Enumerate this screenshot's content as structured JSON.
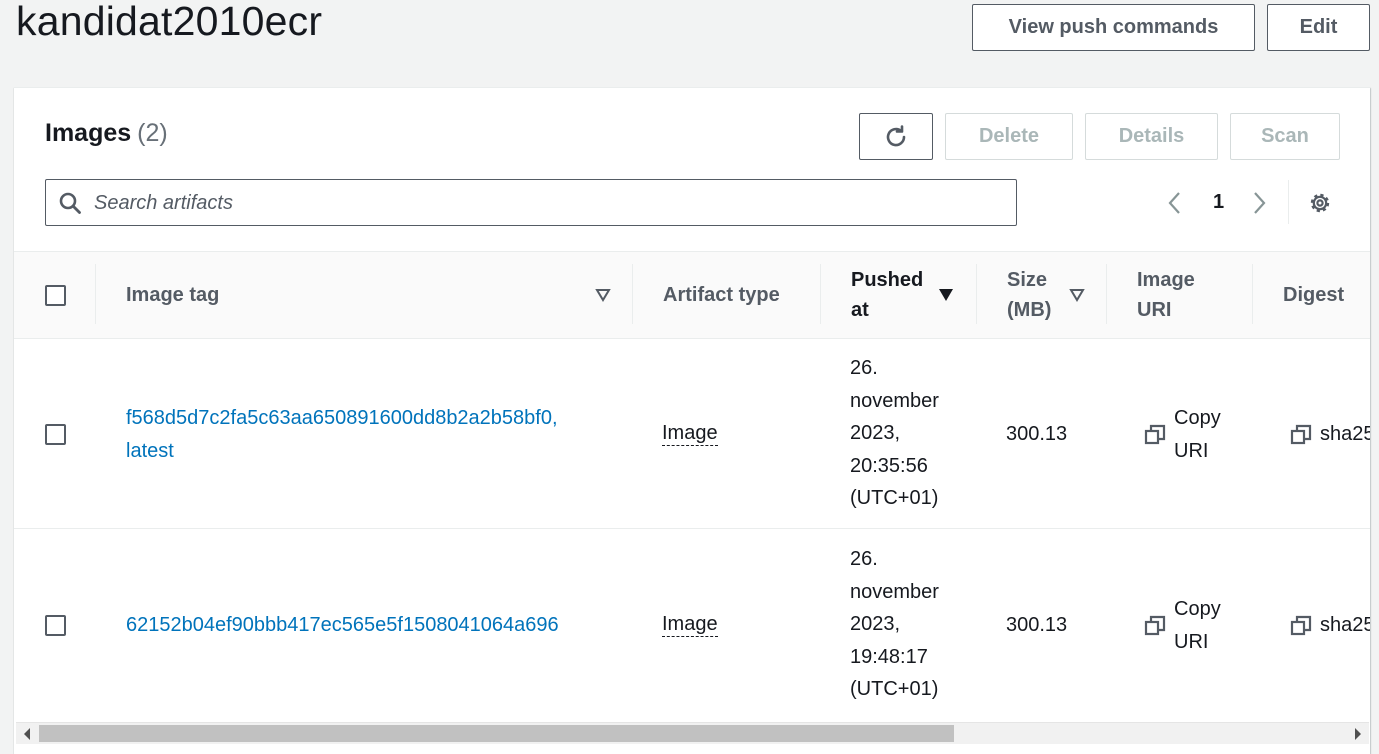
{
  "header": {
    "title": "kandidat2010ecr",
    "view_push_commands": "View push commands",
    "edit": "Edit"
  },
  "images_panel": {
    "title": "Images",
    "count": "(2)",
    "delete": "Delete",
    "details": "Details",
    "scan": "Scan",
    "search_placeholder": "Search artifacts",
    "page": "1"
  },
  "table": {
    "headers": {
      "image_tag": "Image tag",
      "artifact_type": "Artifact type",
      "pushed_at_1": "Pushed",
      "pushed_at_2": "at",
      "size_1": "Size",
      "size_2": "(MB)",
      "image_uri_1": "Image",
      "image_uri_2": "URI",
      "digest": "Digest"
    },
    "rows": [
      {
        "tag_1": "f568d5d7c2fa5c63aa650891600dd8b2a2b58bf0,",
        "tag_2": "latest",
        "artifact_type": "Image",
        "pushed_1": "26.",
        "pushed_2": "november",
        "pushed_3": "2023,",
        "pushed_4": "20:35:56",
        "pushed_5": "(UTC+01)",
        "size": "300.13",
        "copy_1": "Copy",
        "copy_2": "URI",
        "digest": "sha25"
      },
      {
        "tag_1": "62152b04ef90bbb417ec565e5f1508041064a696",
        "tag_2": "",
        "artifact_type": "Image",
        "pushed_1": "26.",
        "pushed_2": "november",
        "pushed_3": "2023,",
        "pushed_4": "19:48:17",
        "pushed_5": "(UTC+01)",
        "size": "300.13",
        "copy_1": "Copy",
        "copy_2": "URI",
        "digest": "sha25"
      }
    ]
  },
  "icons": {
    "refresh": "refresh-icon",
    "search": "search-icon",
    "prev": "chevron-left-icon",
    "next": "chevron-right-icon",
    "settings": "gear-icon",
    "copy": "copy-icon",
    "sort": "caret-down-icon"
  }
}
